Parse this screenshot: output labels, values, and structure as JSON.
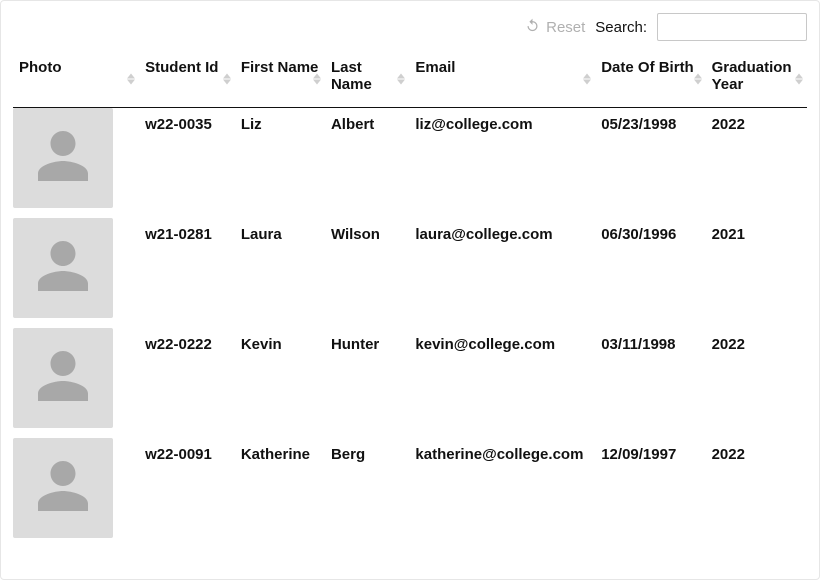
{
  "controls": {
    "reset_label": "Reset",
    "search_label": "Search:",
    "search_value": ""
  },
  "columns": [
    {
      "key": "photo",
      "label": "Photo",
      "sortable": true
    },
    {
      "key": "student_id",
      "label": "Student Id",
      "sortable": true
    },
    {
      "key": "first_name",
      "label": "First Name",
      "sortable": true
    },
    {
      "key": "last_name",
      "label": "Last Name",
      "sortable": true
    },
    {
      "key": "email",
      "label": "Email",
      "sortable": true
    },
    {
      "key": "dob",
      "label": "Date Of Birth",
      "sortable": true
    },
    {
      "key": "graduation_year",
      "label": "Graduation Year",
      "sortable": true
    }
  ],
  "students": [
    {
      "student_id": "w22-0035",
      "first_name": "Liz",
      "last_name": "Albert",
      "email": "liz@college.com",
      "dob": "05/23/1998",
      "graduation_year": "2022"
    },
    {
      "student_id": "w21-0281",
      "first_name": "Laura",
      "last_name": "Wilson",
      "email": "laura@college.com",
      "dob": "06/30/1996",
      "graduation_year": "2021"
    },
    {
      "student_id": "w22-0222",
      "first_name": "Kevin",
      "last_name": "Hunter",
      "email": "kevin@college.com",
      "dob": "03/11/1998",
      "graduation_year": "2022"
    },
    {
      "student_id": "w22-0091",
      "first_name": "Katherine",
      "last_name": "Berg",
      "email": "katherine@college.com",
      "dob": "12/09/1997",
      "graduation_year": "2022"
    }
  ]
}
